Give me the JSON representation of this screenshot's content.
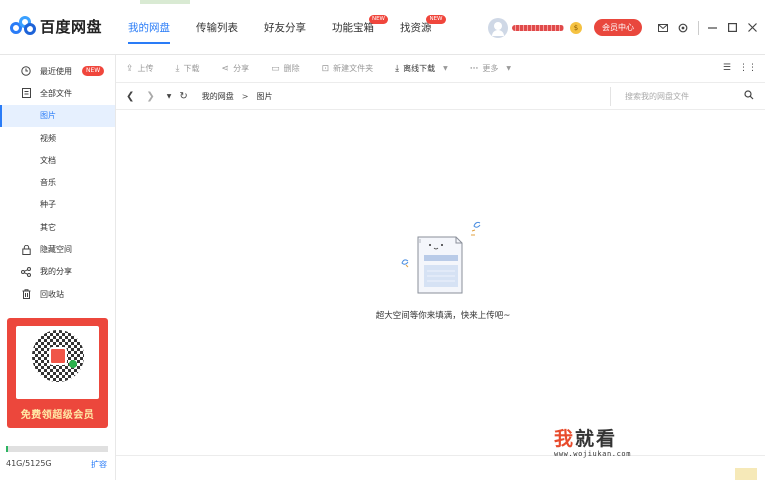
{
  "app": {
    "name": "百度网盘"
  },
  "nav": {
    "tabs": [
      {
        "label": "我的网盘",
        "active": true
      },
      {
        "label": "传输列表"
      },
      {
        "label": "好友分享"
      },
      {
        "label": "功能宝箱",
        "badge": "NEW"
      },
      {
        "label": "找资源",
        "badge": "NEW"
      }
    ]
  },
  "user": {
    "vip_button": "会员中心",
    "coin_symbol": "$"
  },
  "window_controls": [
    "mail-icon",
    "settings-icon",
    "minimize-icon",
    "maximize-icon",
    "close-icon"
  ],
  "sidebar": {
    "items": [
      {
        "label": "最近使用",
        "icon": "clock-icon",
        "badge": "NEW"
      },
      {
        "label": "全部文件",
        "icon": "document-icon"
      },
      {
        "label": "图片",
        "active": true
      },
      {
        "label": "视频"
      },
      {
        "label": "文档"
      },
      {
        "label": "音乐"
      },
      {
        "label": "种子"
      },
      {
        "label": "其它"
      },
      {
        "label": "隐藏空间",
        "icon": "lock-icon"
      },
      {
        "label": "我的分享",
        "icon": "share-icon"
      },
      {
        "label": "回收站",
        "icon": "trash-icon"
      }
    ],
    "promo_text": "免费领超级会员",
    "storage": {
      "text": "41G/5125G",
      "used_fraction": 0.008,
      "expand_label": "扩容"
    }
  },
  "toolbar": {
    "buttons": [
      {
        "label": "上传",
        "icon": "upload-icon",
        "enabled": false
      },
      {
        "label": "下载",
        "icon": "download-icon",
        "enabled": false
      },
      {
        "label": "分享",
        "icon": "share-icon",
        "enabled": false
      },
      {
        "label": "删除",
        "icon": "delete-icon",
        "enabled": false
      },
      {
        "label": "新建文件夹",
        "icon": "new-folder-icon",
        "enabled": false
      },
      {
        "label": "离线下载",
        "icon": "offline-download-icon",
        "enabled": true,
        "caret": true
      },
      {
        "label": "更多",
        "icon": "more-icon",
        "enabled": false,
        "caret": true
      }
    ]
  },
  "breadcrumb": {
    "root": "我的网盘",
    "separator": ">",
    "current": "图片"
  },
  "search": {
    "placeholder": "搜索我的网盘文件"
  },
  "empty_state": {
    "message": "超大空间等你来填满，快来上传吧~"
  },
  "watermark": {
    "title_accent": "我",
    "title_rest": "就看",
    "url": "www.wojiukan.com"
  },
  "colors": {
    "accent": "#2a7cf7",
    "badge": "#f0463c",
    "promo": "#ec473c",
    "storage": "#2cb460"
  }
}
